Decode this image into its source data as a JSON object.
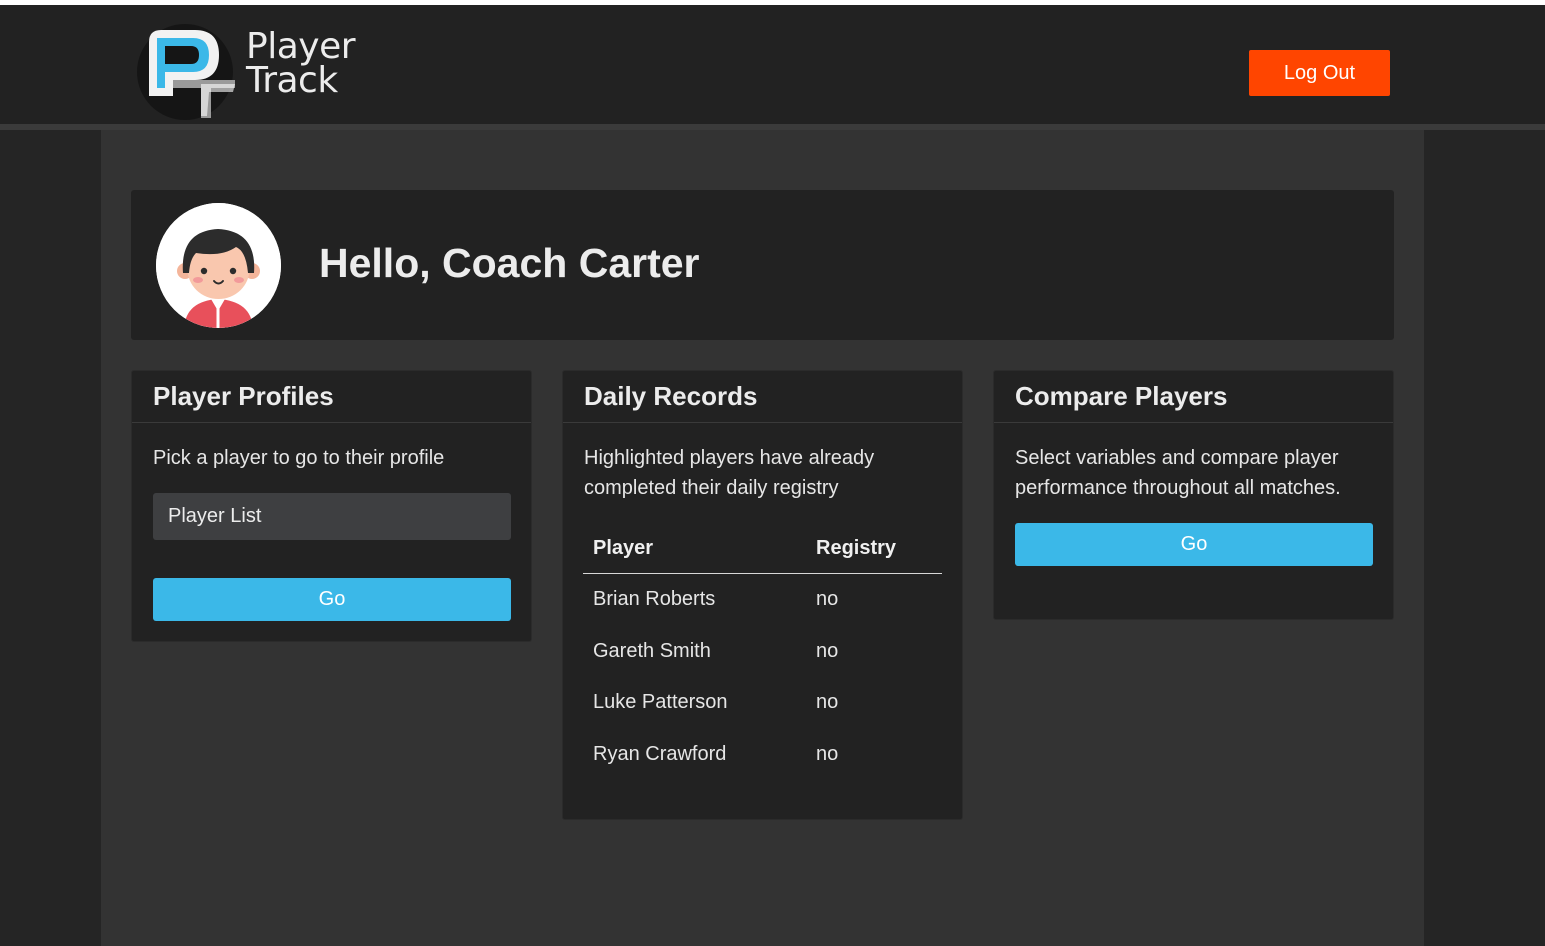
{
  "brand": {
    "line1": "Player",
    "line2": "Track",
    "logo_icon": "player-track-logo-icon",
    "colors": {
      "logo_blue": "#3bb8e8",
      "logo_dark": "#151515"
    }
  },
  "header": {
    "logout_label": "Log Out",
    "logout_color": "#ff4500"
  },
  "greeting": {
    "text": "Hello, Coach Carter",
    "avatar_icon": "coach-avatar-icon"
  },
  "player_profiles": {
    "title": "Player Profiles",
    "description": "Pick a player to go to their profile",
    "select_value": "Player List",
    "go_label": "Go"
  },
  "daily_records": {
    "title": "Daily Records",
    "description": "Highlighted players have already completed their daily registry",
    "columns": [
      "Player",
      "Registry"
    ],
    "rows": [
      {
        "player": "Brian Roberts",
        "registry": "no"
      },
      {
        "player": "Gareth Smith",
        "registry": "no"
      },
      {
        "player": "Luke Patterson",
        "registry": "no"
      },
      {
        "player": "Ryan Crawford",
        "registry": "no"
      }
    ]
  },
  "compare_players": {
    "title": "Compare Players",
    "description": "Select variables and compare player performance throughout all matches.",
    "go_label": "Go",
    "button_color": "#3bb8e8"
  }
}
